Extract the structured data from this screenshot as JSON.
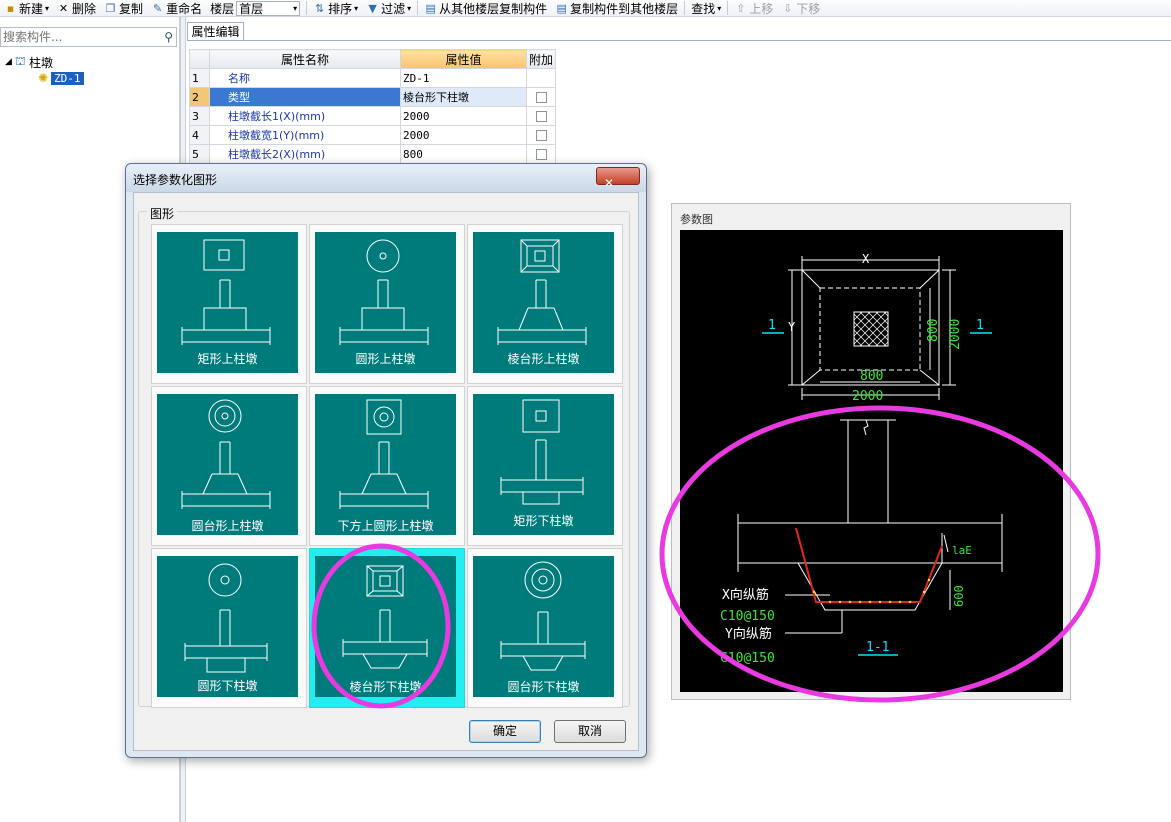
{
  "toolbar": {
    "new_label": "新建",
    "delete_label": "删除",
    "copy_label": "复制",
    "rename_label": "重命名",
    "floor_label": "楼层",
    "floor_value": "首层",
    "sort_label": "排序",
    "filter_label": "过滤",
    "copy_from_other_floor_label": "从其他楼层复制构件",
    "copy_to_other_floor_label": "复制构件到其他楼层",
    "find_label": "查找",
    "move_up_label": "上移",
    "move_down_label": "下移"
  },
  "tree": {
    "search_placeholder": "搜索构件...",
    "root_label": "柱墩",
    "leaf_label": "ZD-1"
  },
  "property_editor": {
    "tab_label": "属性编辑",
    "columns": [
      "属性名称",
      "属性值",
      "附加"
    ],
    "rows": [
      {
        "num": "1",
        "name": "名称",
        "value": "ZD-1",
        "has_check": false
      },
      {
        "num": "2",
        "name": "类型",
        "value": "棱台形下柱墩",
        "has_check": true
      },
      {
        "num": "3",
        "name": "柱墩截长1(X)(mm)",
        "value": "2000",
        "has_check": true
      },
      {
        "num": "4",
        "name": "柱墩截宽1(Y)(mm)",
        "value": "2000",
        "has_check": true
      },
      {
        "num": "5",
        "name": "柱墩截长2(X)(mm)",
        "value": "800",
        "has_check": true
      }
    ]
  },
  "dialog": {
    "title": "选择参数化图形",
    "group_label": "图形",
    "shapes": [
      {
        "label": "矩形上柱墩"
      },
      {
        "label": "圆形上柱墩"
      },
      {
        "label": "棱台形上柱墩"
      },
      {
        "label": "圆台形上柱墩"
      },
      {
        "label": "下方上圆形上柱墩"
      },
      {
        "label": "矩形下柱墩"
      },
      {
        "label": "圆形下柱墩"
      },
      {
        "label": "棱台形下柱墩"
      },
      {
        "label": "圆台形下柱墩"
      }
    ],
    "selected_shape": "棱台形下柱墩",
    "ok_label": "确定",
    "cancel_label": "取消"
  },
  "param_panel": {
    "title": "参数图",
    "dim_x": "X",
    "dim_y": "Y",
    "dim_800_v": "800",
    "dim_2000_v": "2000",
    "dim_800_h": "800",
    "dim_2000_h": "2000",
    "section_mark": "1",
    "lae_label": "laE",
    "depth_label": "600",
    "x_rebar_label": "X向纵筋",
    "x_rebar_spec": "C10@150",
    "y_rebar_label": "Y向纵筋",
    "y_rebar_spec": "C10@150",
    "section_title": "1-1"
  },
  "colors": {
    "tile_bg": "#007b7b",
    "tile_selected_border": "#22eef0",
    "highlight_ellipse": "#e83ae0",
    "header_accent": "#f8c56b",
    "selected_row": "#3a78d2"
  }
}
